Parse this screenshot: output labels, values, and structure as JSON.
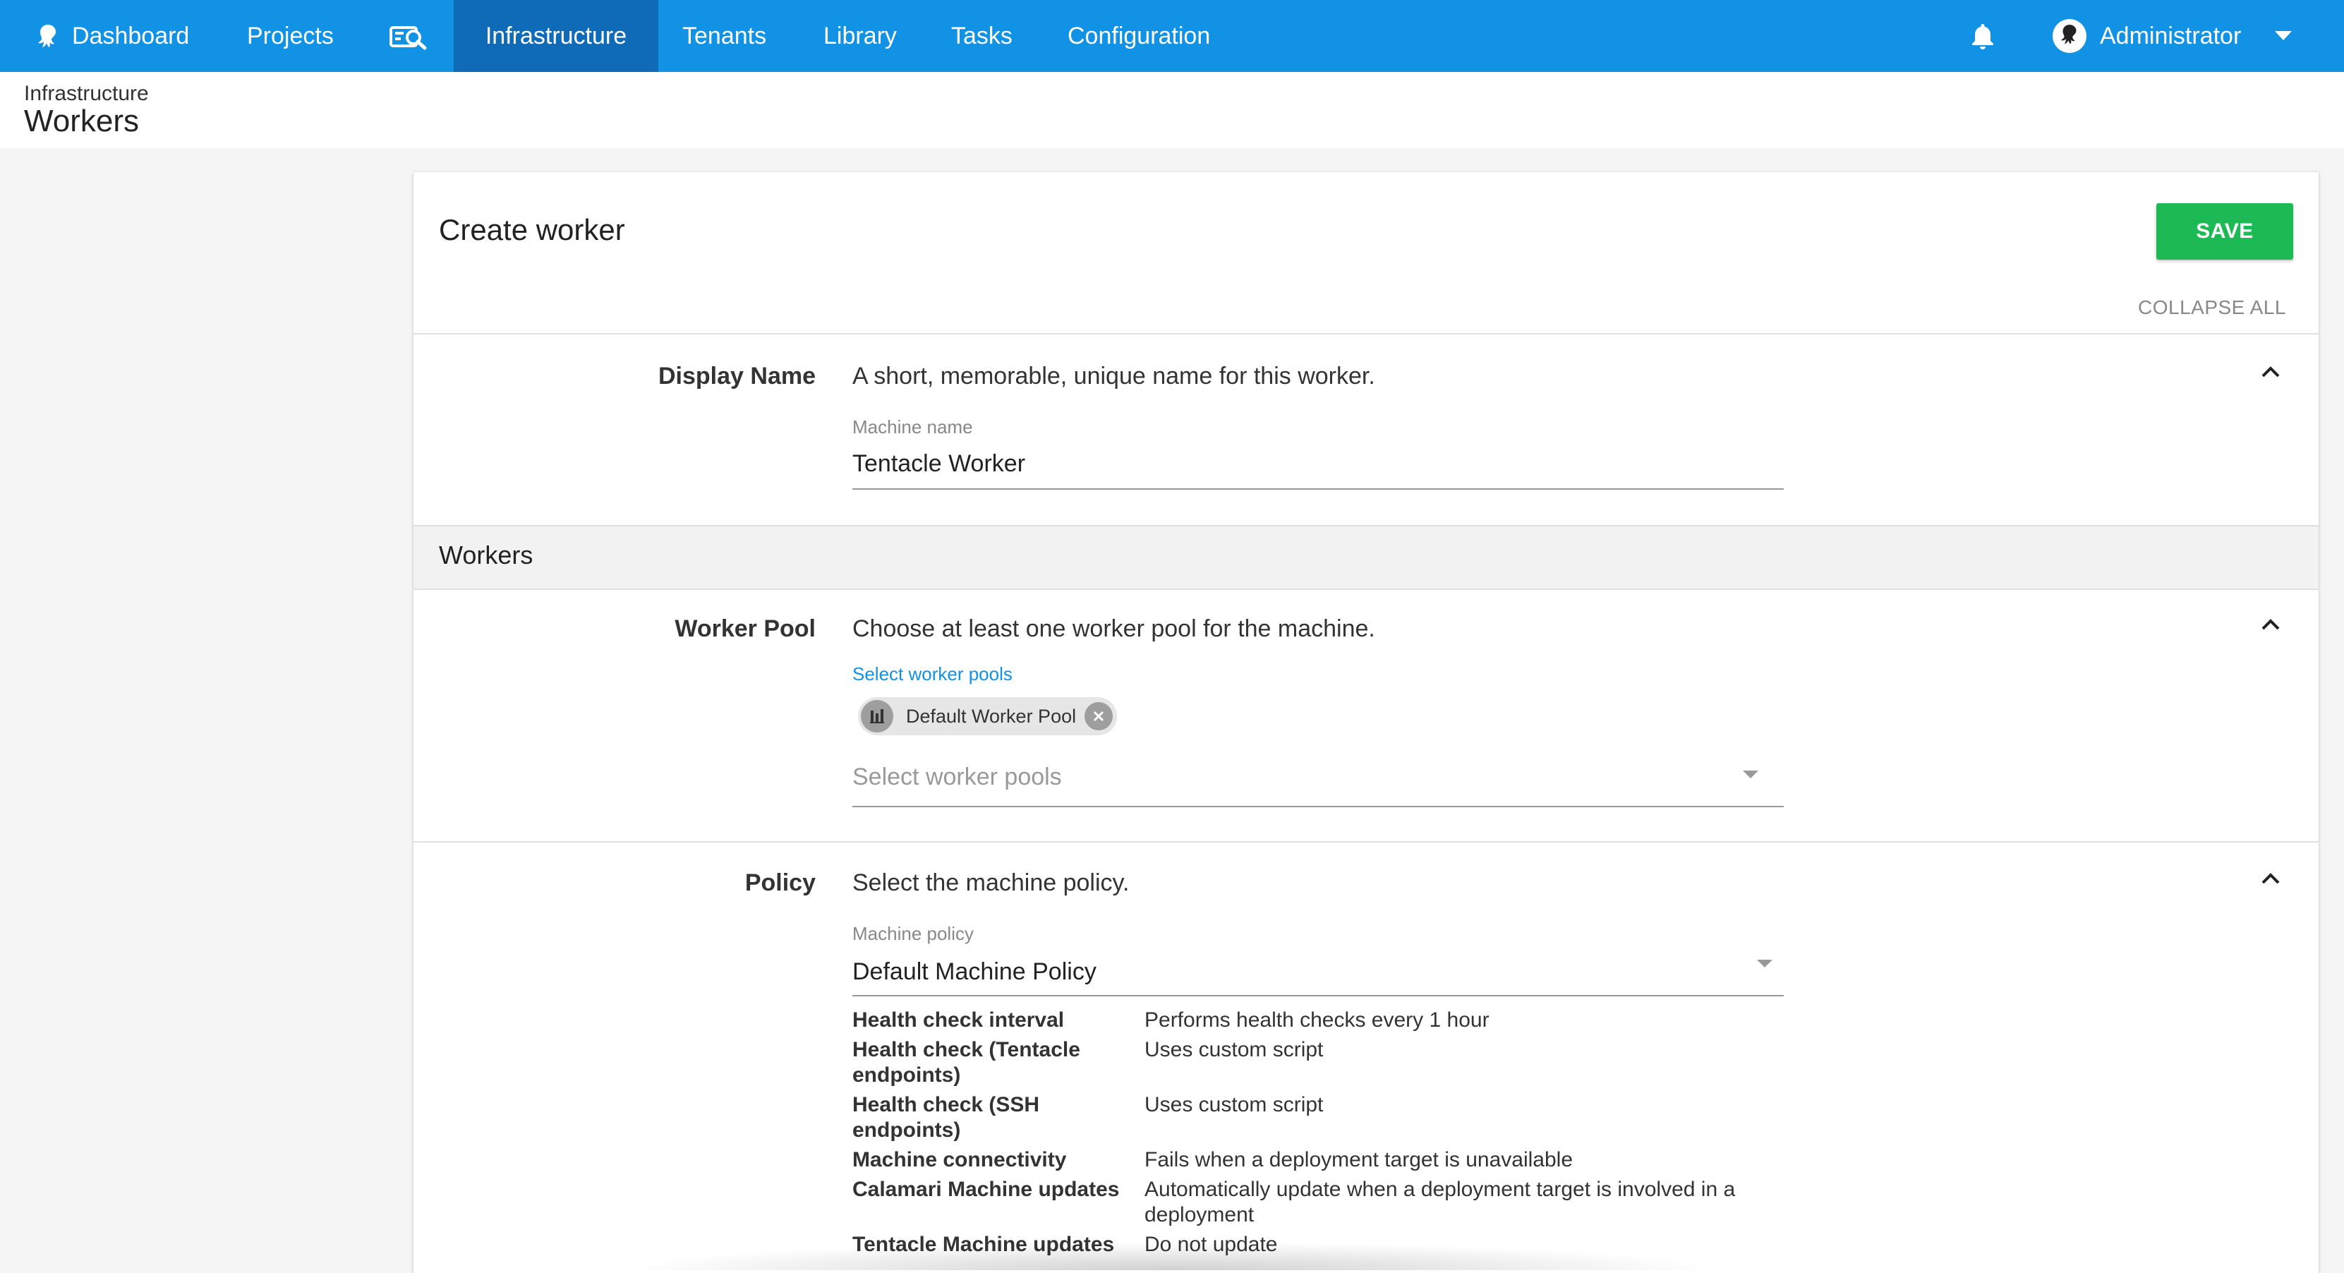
{
  "nav": {
    "dashboard": "Dashboard",
    "projects": "Projects",
    "search_icon": "search-machines-icon",
    "infrastructure": "Infrastructure",
    "tenants": "Tenants",
    "library": "Library",
    "tasks": "Tasks",
    "configuration": "Configuration",
    "user": "Administrator",
    "accent": "#1192e5",
    "active_bg": "#0f6bb7"
  },
  "header": {
    "breadcrumb": "Infrastructure",
    "title": "Workers"
  },
  "form": {
    "title": "Create worker",
    "save_label": "SAVE",
    "collapse_all": "COLLAPSE ALL",
    "display_name": {
      "label": "Display Name",
      "description": "A short, memorable, unique name for this worker.",
      "field_label": "Machine name",
      "value": "Tentacle Worker"
    },
    "workers_section": "Workers",
    "worker_pool": {
      "label": "Worker Pool",
      "description": "Choose at least one worker pool for the machine.",
      "select_label": "Select worker pools",
      "chips": [
        "Default Worker Pool"
      ],
      "placeholder": "Select worker pools"
    },
    "policy": {
      "label": "Policy",
      "description": "Select the machine policy.",
      "field_label": "Machine policy",
      "value": "Default Machine Policy",
      "details": [
        {
          "key": "Health check interval",
          "value": "Performs health checks every 1 hour"
        },
        {
          "key": "Health check (Tentacle endpoints)",
          "value": "Uses custom script"
        },
        {
          "key": "Health check (SSH endpoints)",
          "value": "Uses custom script"
        },
        {
          "key": "Machine connectivity",
          "value": "Fails when a deployment target is unavailable"
        },
        {
          "key": "Calamari Machine updates",
          "value": "Automatically update when a deployment target is involved in a deployment"
        },
        {
          "key": "Tentacle Machine updates",
          "value": "Do not update"
        }
      ]
    },
    "save_color": "#1db954"
  }
}
